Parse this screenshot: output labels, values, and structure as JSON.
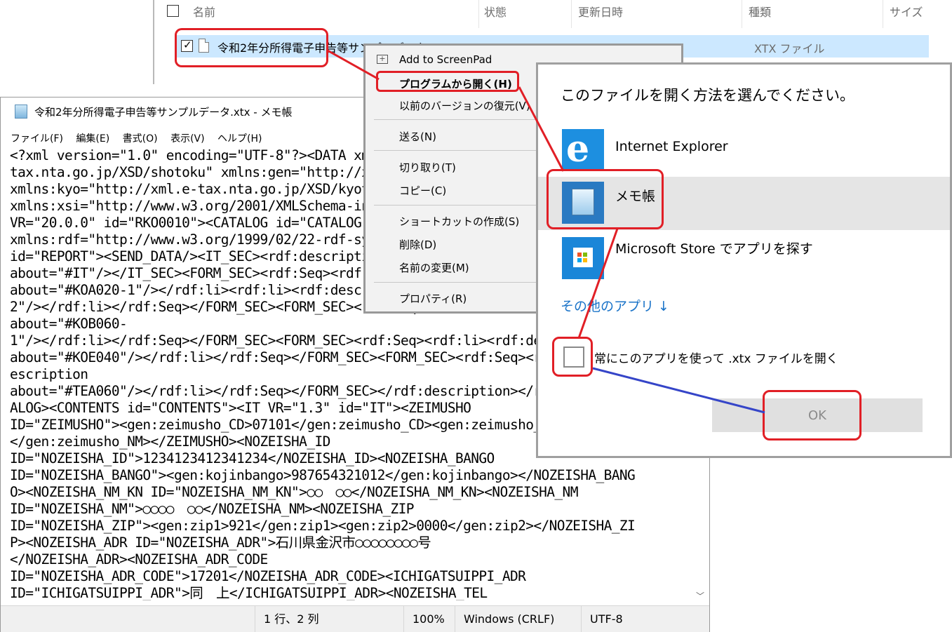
{
  "explorer": {
    "columns": {
      "name": "名前",
      "status": "状態",
      "modified": "更新日時",
      "type": "種類",
      "size": "サイズ"
    },
    "file": {
      "name": "令和2年分所得電子申告等サンプルデータ.xtx",
      "type": "XTX ファイル"
    }
  },
  "notepad": {
    "title": "令和2年分所得電子申告等サンプルデータ.xtx - メモ帳",
    "menu": [
      "ファイル(F)",
      "編集(E)",
      "書式(O)",
      "表示(V)",
      "ヘルプ(H)"
    ],
    "content": "<?xml version=\"1.0\" encoding=\"UTF-8\"?><DATA xmlns=\"http://xml.e-\ntax.nta.go.jp/XSD/shotoku\" xmlns:gen=\"http://xml.e-tax.nta.go.jp/XSD/general\"\nxmlns:kyo=\"http://xml.e-tax.nta.go.jp/XSD/kyotsu\"\nxmlns:xsi=\"http://www.w3.org/2001/XMLSchema-instance\" id=\"DATA\"><RKO0010\nVR=\"20.0.0\" id=\"RKO0010\"><CATALOG id=\"CATALOG\"><rdf:RDF\nxmlns:rdf=\"http://www.w3.org/1999/02/22-rdf-syntax-ns#\"><rdf:description\nid=\"REPORT\"><SEND_DATA/><IT_SEC><rdf:description\nabout=\"#IT\"/></IT_SEC><FORM_SEC><rdf:Seq><rdf:li><rdf:description\nabout=\"#KOA020-1\"/></rdf:li><rdf:li><rdf:description about=\"#KOA020-\n2\"/></rdf:li></rdf:Seq></FORM_SEC><FORM_SEC><rdf:Seq><rdf:li><rdf:description\nabout=\"#KOB060-\n1\"/></rdf:li></rdf:Seq></FORM_SEC><FORM_SEC><rdf:Seq><rdf:li><rdf:description\nabout=\"#KOE040\"/></rdf:li></rdf:Seq></FORM_SEC><FORM_SEC><rdf:Seq><rdf:li><rdf:d\nescription\nabout=\"#TEA060\"/></rdf:li></rdf:Seq></FORM_SEC></rdf:description></rdf:RDF></CAT\nALOG><CONTENTS id=\"CONTENTS\"><IT VR=\"1.3\" id=\"IT\"><ZEIMUSHO\nID=\"ZEIMUSHO\"><gen:zeimusho_CD>07101</gen:zeimusho_CD><gen:zeimusho_NM>金沢\n</gen:zeimusho_NM></ZEIMUSHO><NOZEISHA_ID\nID=\"NOZEISHA_ID\">1234123412341234</NOZEISHA_ID><NOZEISHA_BANGO\nID=\"NOZEISHA_BANGO\"><gen:kojinbango>987654321012</gen:kojinbango></NOZEISHA_BANG\nO><NOZEISHA_NM_KN ID=\"NOZEISHA_NM_KN\">○○　○○</NOZEISHA_NM_KN><NOZEISHA_NM\nID=\"NOZEISHA_NM\">○○○○　○○</NOZEISHA_NM><NOZEISHA_ZIP\nID=\"NOZEISHA_ZIP\"><gen:zip1>921</gen:zip1><gen:zip2>0000</gen:zip2></NOZEISHA_ZI\nP><NOZEISHA_ADR ID=\"NOZEISHA_ADR\">石川県金沢市○○○○○○○○号\n</NOZEISHA_ADR><NOZEISHA_ADR_CODE\nID=\"NOZEISHA_ADR_CODE\">17201</NOZEISHA_ADR_CODE><ICHIGATSUIPPI_ADR\nID=\"ICHIGATSUIPPI_ADR\">同　上</ICHIGATSUIPPI_ADR><NOZEISHA_TEL",
    "status": {
      "position": "1 行、2 列",
      "zoom": "100%",
      "line_ending": "Windows (CRLF)",
      "encoding": "UTF-8"
    }
  },
  "context_menu": {
    "add_screenpad": "Add to ScreenPad",
    "open_with": "プログラムから開く(H)",
    "restore": "以前のバージョンの復元(V)",
    "send_to": "送る(N)",
    "cut": "切り取り(T)",
    "copy": "コピー(C)",
    "create_shortcut": "ショートカットの作成(S)",
    "delete": "削除(D)",
    "rename": "名前の変更(M)",
    "properties": "プロパティ(R)"
  },
  "open_with": {
    "title": "このファイルを開く方法を選んでください。",
    "apps": {
      "ie": "Internet Explorer",
      "notepad": "メモ帳",
      "store": "Microsoft Store でアプリを探す"
    },
    "more_apps": "その他のアプリ ↓",
    "always_use": "常にこのアプリを使って .xtx ファイルを開く",
    "ok": "OK"
  },
  "colors": {
    "highlight": "#e11f26",
    "connector_blue": "#3545c8",
    "selection": "#cce8ff",
    "selected_app": "#e5e5e5",
    "link": "#1a73c8"
  }
}
